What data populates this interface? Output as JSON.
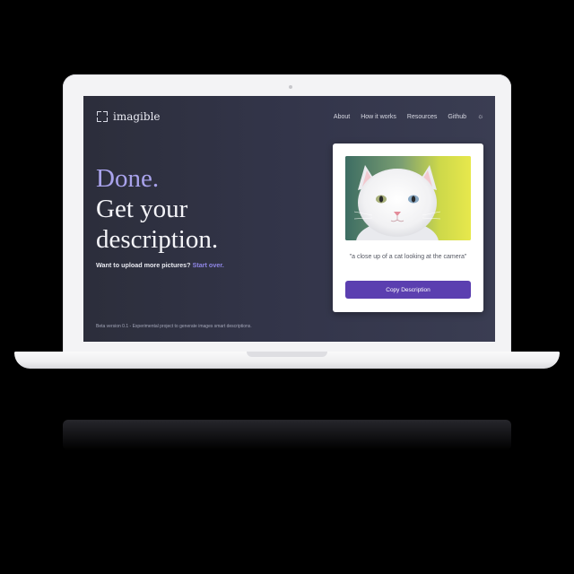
{
  "header": {
    "logo_text": "imagible",
    "nav": [
      {
        "label": "About"
      },
      {
        "label": "How it works"
      },
      {
        "label": "Resources"
      },
      {
        "label": "Github"
      }
    ],
    "theme_toggle_icon": "sun-icon"
  },
  "hero": {
    "line1": "Done.",
    "line2": "Get your",
    "line3": "description."
  },
  "upload": {
    "prompt": "Want to upload more pictures?",
    "link": "Start over."
  },
  "result": {
    "caption": "\"a close up of a cat looking at the camera\"",
    "copy_button": "Copy Description"
  },
  "footer": {
    "note": "Beta version 0.1 - Experimental project to generate images smart descriptions."
  },
  "colors": {
    "accent": "#5b3fb0",
    "hero_accent": "#a9a3ec",
    "link": "#8f86e6",
    "background": "#2c2e3b"
  }
}
